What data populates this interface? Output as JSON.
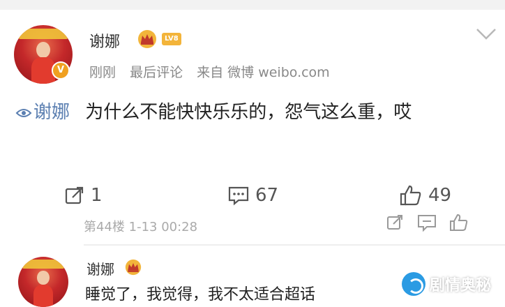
{
  "comment": {
    "author": "谢娜",
    "level_badge": "LV8",
    "meta": {
      "time": "刚刚",
      "sort": "最后评论",
      "source": "来自 微博 weibo.com"
    },
    "mention": "谢娜",
    "text": "为什么不能快快乐乐的，怨气这么重，哎",
    "actions": {
      "repost_count": "1",
      "comment_count": "67",
      "like_count": "49"
    },
    "floor": "第44楼 1-13 00:28"
  },
  "reply": {
    "author": "谢娜",
    "text": "睡觉了，我觉得，我不太适合超话"
  },
  "watermark": {
    "text": "剧情奥秘"
  },
  "icons": {
    "crown": "crown-icon",
    "verified": "verified-v-icon",
    "chevron": "chevron-down-icon",
    "repost": "repost-icon",
    "comment": "comment-icon",
    "like": "thumbs-up-icon",
    "mention": "mention-icon"
  },
  "colors": {
    "mention": "#5b7fb1",
    "badge": "#f3b43a",
    "avatar_red": "#c4282a"
  }
}
